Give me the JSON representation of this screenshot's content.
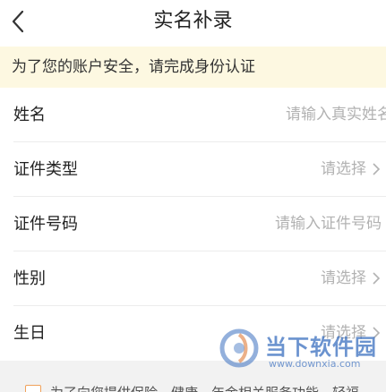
{
  "header": {
    "title": "实名补录",
    "back_icon": "chevron-left-icon"
  },
  "notice": {
    "text": "为了您的账户安全，请完成身份认证"
  },
  "form": {
    "rows": [
      {
        "label": "姓名",
        "placeholder": "请输入真实姓名",
        "has_chevron": false
      },
      {
        "label": "证件类型",
        "placeholder": "请选择",
        "has_chevron": true
      },
      {
        "label": "证件号码",
        "placeholder": "请输入证件号码",
        "has_chevron": false
      },
      {
        "label": "性别",
        "placeholder": "请选择",
        "has_chevron": true
      },
      {
        "label": "生日",
        "placeholder": "请选择",
        "has_chevron": true
      }
    ]
  },
  "agreement": {
    "text": "为了向您提供保险、健康、年金相关服务功能，轻福"
  },
  "watermark": {
    "name": "当下软件园",
    "url": "www.downxia.com"
  },
  "colors": {
    "notice_bg": "#fdf8e1",
    "placeholder": "#b2b2b2",
    "checkbox_border": "#f0a15a",
    "watermark": "#3a6fbf"
  }
}
